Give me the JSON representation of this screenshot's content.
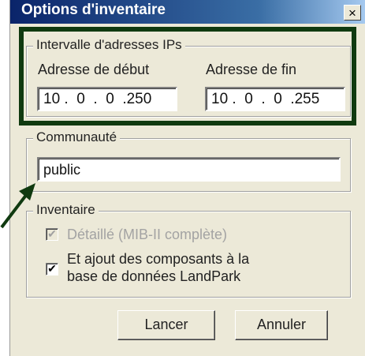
{
  "window": {
    "title": "Options d'inventaire",
    "close_glyph": "×"
  },
  "ip_range": {
    "legend": "Intervalle d'adresses IPs",
    "start_label": "Adresse de début",
    "start_value": "10 .  0  .  0  .250",
    "end_label": "Adresse de fin",
    "end_value": "10 .  0  .  0  .255"
  },
  "community": {
    "legend": "Communauté",
    "value": "public"
  },
  "inventory": {
    "legend": "Inventaire",
    "detailed_label": "Détaillé (MIB-II complète)",
    "detailed_checked": true,
    "add_components_label": "Et ajout des composants à la base de données LandPark",
    "add_components_checked": true,
    "check_glyph": "✔"
  },
  "buttons": {
    "launch": "Lancer",
    "cancel": "Annuler"
  },
  "annotation": {
    "highlight_color": "#103a10",
    "arrow_color": "#103a10"
  }
}
